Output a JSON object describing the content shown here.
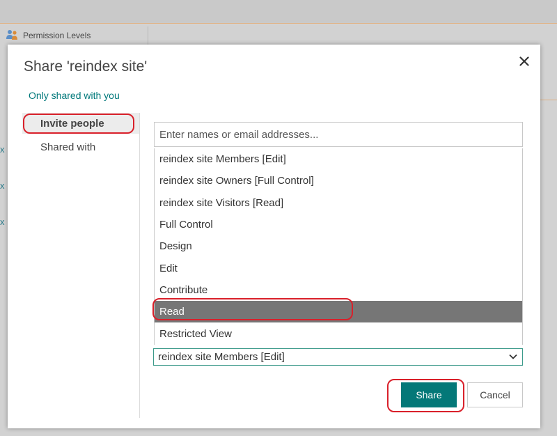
{
  "background": {
    "permission_levels_label": "Permission Levels",
    "side_marks": [
      "x",
      "x",
      "x"
    ]
  },
  "dialog": {
    "title": "Share 'reindex site'",
    "shared_status": "Only shared with you",
    "close_icon": "close-icon",
    "nav": [
      {
        "label": "Invite people",
        "active": true
      },
      {
        "label": "Shared with",
        "active": false
      }
    ],
    "search": {
      "placeholder": "Enter names or email addresses...",
      "value": ""
    },
    "permission_options": [
      "reindex site Members [Edit]",
      "reindex site Owners [Full Control]",
      "reindex site Visitors [Read]",
      "Full Control",
      "Design",
      "Edit",
      "Contribute",
      "Read",
      "Restricted View"
    ],
    "highlighted_option": "Read",
    "selected_permission": "reindex site Members [Edit]",
    "share_label": "Share",
    "cancel_label": "Cancel"
  },
  "colors": {
    "accent_teal": "#047878",
    "link_teal": "#00787a",
    "highlight_gray": "#767676",
    "annotation_red": "#d9202a"
  }
}
